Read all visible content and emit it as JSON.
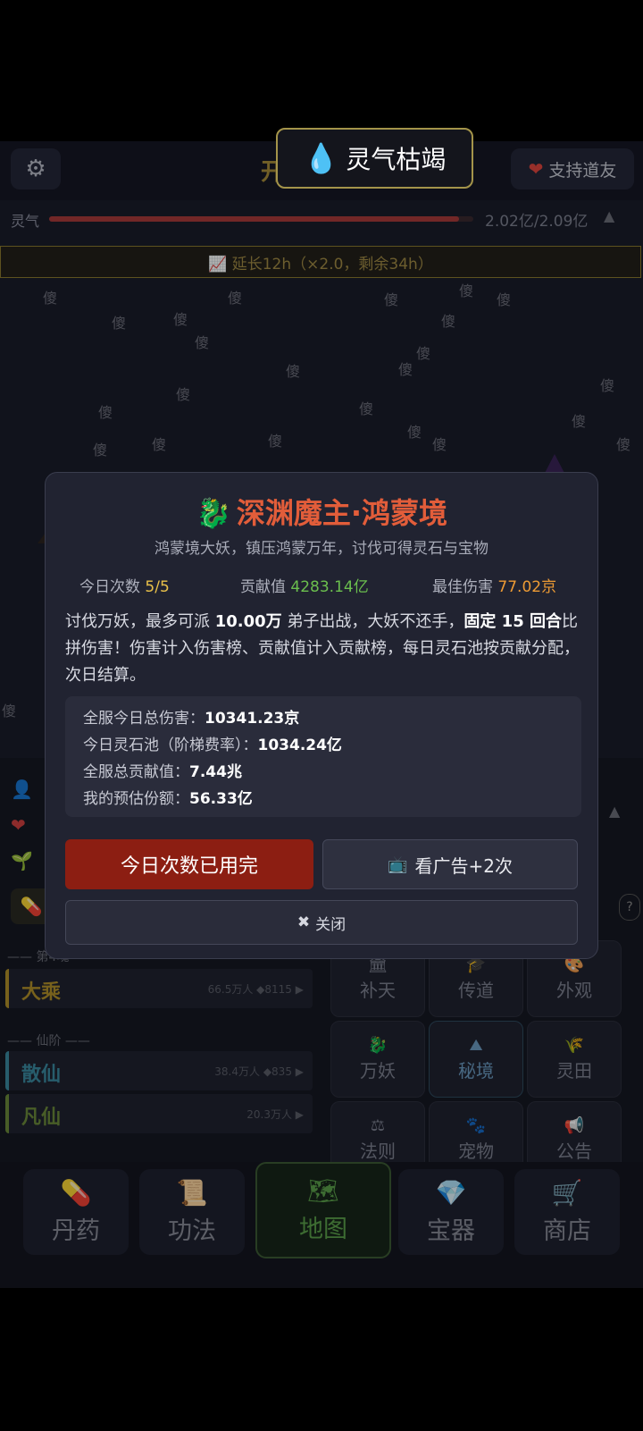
{
  "topbar": {
    "title": "开局立派",
    "support_label": "支持道友"
  },
  "qi": {
    "label": "灵气",
    "value": "2.02亿/2.09亿",
    "progress_fraction": 0.966
  },
  "extend_bar": {
    "text": "📈 延长12h（×2.0，剩余34h）"
  },
  "rain_char": "傻",
  "toast": {
    "text": "灵气枯竭"
  },
  "modal": {
    "title": "深渊魔主·鸿蒙境",
    "subtitle": "鸿蒙境大妖，镇压鸿蒙万年，讨伐可得灵石与宝物",
    "stats": {
      "attempts_label": "今日次数",
      "attempts_value": "5/5",
      "contribution_label": "贡献值",
      "contribution_value": "4283.14亿",
      "best_label": "最佳伤害",
      "best_value": "77.02京"
    },
    "desc": {
      "p1": "讨伐万妖，最多可派 ",
      "n1": "10.00万",
      "p2": " 弟子出战，大妖不还手，",
      "n2": "固定 15 回合",
      "p3": "比拼伤害！伤害计入伤害榜、贡献值计入贡献榜，每日灵石池按贡献分配，次日结算。"
    },
    "info": {
      "l1_label": "全服今日总伤害：",
      "l1_value": "10341.23京",
      "l2_label": "今日灵石池（阶梯费率）：",
      "l2_value": "1034.24亿",
      "l3_label": "全服总贡献值：",
      "l3_value": "7.44兆",
      "l4_label": "我的预估份额：",
      "l4_value": "56.33亿"
    },
    "btn_used": "今日次数已用完",
    "btn_ad": "看广告+2次",
    "btn_close": "关闭"
  },
  "realms": {
    "section1": "第4魂",
    "item1_name": "大乘",
    "item1_meta": "66.5万人 ◆8115 ▶",
    "section2": "仙阶",
    "item2_name": "散仙",
    "item2_meta": "38.4万人 ◆835 ▶",
    "item3_name": "凡仙",
    "item3_meta": "20.3万人 ▶"
  },
  "grid": [
    "补天",
    "传道",
    "外观",
    "万妖",
    "秘境",
    "灵田",
    "法则",
    "宠物",
    "公告"
  ],
  "nav": [
    "丹药",
    "功法",
    "地图",
    "宝器",
    "商店"
  ],
  "colors": {
    "title_red": "#e25d3a",
    "gold": "#e8c04a",
    "green": "#6bbf4e",
    "button_red": "#8c1e12"
  }
}
